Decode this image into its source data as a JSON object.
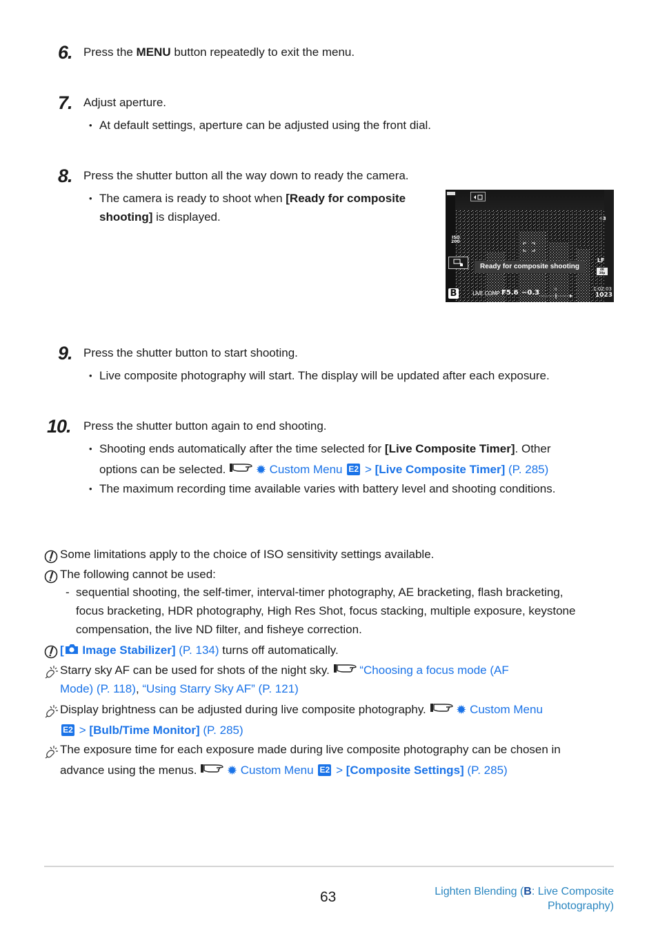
{
  "steps": [
    {
      "number": "6.",
      "text_pre": "Press the ",
      "text_bold": "MENU",
      "text_post": " button repeatedly to exit the menu."
    },
    {
      "number": "7.",
      "text": "Adjust aperture.",
      "bullets": [
        "At default settings, aperture can be adjusted using the front dial."
      ]
    },
    {
      "number": "8.",
      "text": "Press the shutter button all the way down to ready the camera.",
      "bullet_pre": "The camera is ready to shoot when ",
      "bullet_bold_1": "[Ready for composite",
      "bullet_bold_2": "shooting]",
      "bullet_post": " is displayed."
    },
    {
      "number": "9.",
      "text": "Press the shutter button to start shooting.",
      "bullets": [
        "Live composite photography will start. The display will be updated after each exposure."
      ]
    },
    {
      "number": "10.",
      "text": "Press the shutter button again to end shooting.",
      "bullet1_pre": "Shooting ends automatically after the time selected for ",
      "bullet1_bold": "[Live Composite Timer]",
      "bullet1_post": ". Other",
      "bullet1_line2": "options can be selected.",
      "bullet1_link_menu": "Custom Menu",
      "bullet1_link_tab": "E2",
      "bullet1_sep": ">",
      "bullet1_link_item": "[Live Composite Timer]",
      "bullet1_link_page": "(P. 285)",
      "bullet2": "The maximum recording time available varies with battery level and shooting conditions."
    }
  ],
  "camera_screen": {
    "status_banner": "Ready for composite shooting",
    "mode": "B",
    "mode_label": "LIVE COMP",
    "aperture": "F5.6",
    "exposure_comp": "−0.3",
    "scale_zero": "0",
    "iso_label": "ISO",
    "iso_value": "200",
    "quality": "LF",
    "video_top": "4K",
    "video_bottom": "30p",
    "record_time": "1:02:03",
    "shots_remaining": "1023",
    "flash_value": "3"
  },
  "notes": [
    {
      "type": "caution",
      "text": "Some limitations apply to the choice of ISO sensitivity settings available."
    },
    {
      "type": "caution",
      "text": "The following cannot be used:",
      "sub_dash": "-",
      "sub_lines": [
        "sequential shooting, the self-timer, interval-timer photography, AE bracketing, flash bracketing,",
        "focus bracketing, HDR photography, High Res Shot, focus stacking, multiple exposure, keystone",
        "compensation, the live ND filter, and fisheye correction."
      ]
    },
    {
      "type": "caution",
      "link_open": "[",
      "link_bold": "Image Stabilizer]",
      "link_page": "(P. 134)",
      "text_post": " turns off automatically."
    },
    {
      "type": "tip",
      "text": "Starry sky AF can be used for shots of the night sky.",
      "link1": "“Choosing a focus mode (AF",
      "link1_line2": "Mode) (P. 118)",
      "sep": ", ",
      "link2": "“Using Starry Sky AF” (P. 121)"
    },
    {
      "type": "tip",
      "text": "Display brightness can be adjusted during live composite photography.",
      "link_menu": "Custom Menu",
      "link_tab": "E2",
      "sep": ">",
      "link_item": "[Bulb/Time Monitor]",
      "link_page": "(P. 285)"
    },
    {
      "type": "tip",
      "text_line1": "The exposure time for each exposure made during live composite photography can be chosen in",
      "text_line2": "advance using the menus.",
      "link_menu": "Custom Menu",
      "link_tab": "E2",
      "sep": ">",
      "link_item": "[Composite Settings]",
      "link_page": "(P. 285)"
    }
  ],
  "footer": {
    "page_number": "63",
    "section_pre": "Lighten Blending (",
    "section_mode": "B",
    "section_post_1": ": Live Composite",
    "section_post_2": "Photography)"
  },
  "colors": {
    "link": "#1a73e8",
    "footer_link": "#2a86c0",
    "text": "#1a1a1a"
  }
}
